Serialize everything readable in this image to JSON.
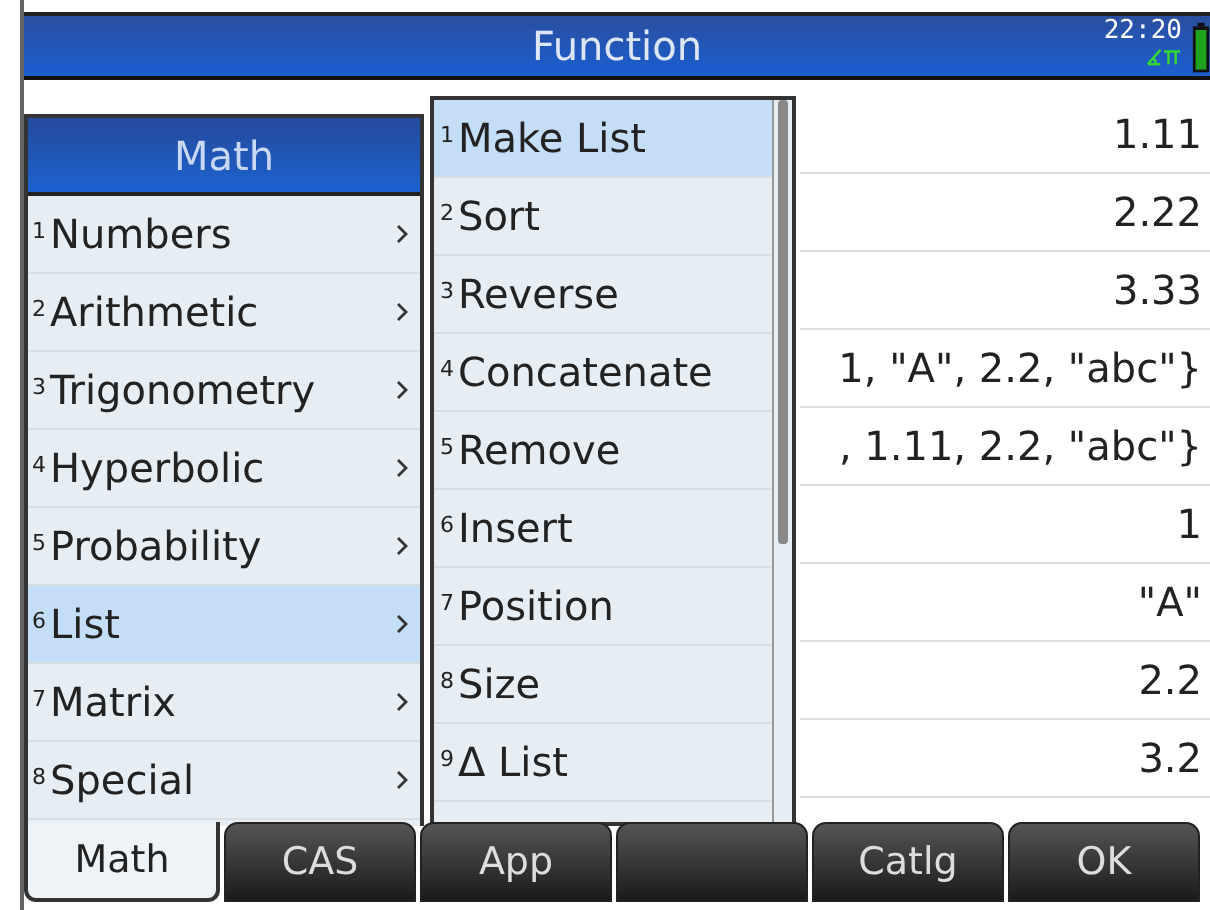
{
  "title_bar": {
    "title": "Function",
    "time": "22:20"
  },
  "history": [
    {
      "value": "1.11"
    },
    {
      "value": "2.22"
    },
    {
      "value": "3.33"
    },
    {
      "value": "1, \"A\", 2.2, \"abc\"}"
    },
    {
      "value": ", 1.11, 2.2, \"abc\"}"
    },
    {
      "value": "1"
    },
    {
      "value": "\"A\""
    },
    {
      "value": "2.2"
    },
    {
      "value": "3.2"
    }
  ],
  "math_menu": {
    "title": "Math",
    "items": [
      {
        "number": "1",
        "label": "Numbers",
        "submenu": true,
        "selected": false
      },
      {
        "number": "2",
        "label": "Arithmetic",
        "submenu": true,
        "selected": false
      },
      {
        "number": "3",
        "label": "Trigonometry",
        "submenu": true,
        "selected": false
      },
      {
        "number": "4",
        "label": "Hyperbolic",
        "submenu": true,
        "selected": false
      },
      {
        "number": "5",
        "label": "Probability",
        "submenu": true,
        "selected": false
      },
      {
        "number": "6",
        "label": "List",
        "submenu": true,
        "selected": true
      },
      {
        "number": "7",
        "label": "Matrix",
        "submenu": true,
        "selected": false
      },
      {
        "number": "8",
        "label": "Special",
        "submenu": true,
        "selected": false
      }
    ]
  },
  "list_submenu": {
    "items": [
      {
        "number": "1",
        "label": "Make List",
        "selected": true
      },
      {
        "number": "2",
        "label": "Sort",
        "selected": false
      },
      {
        "number": "3",
        "label": "Reverse",
        "selected": false
      },
      {
        "number": "4",
        "label": "Concatenate",
        "selected": false
      },
      {
        "number": "5",
        "label": "Remove",
        "selected": false
      },
      {
        "number": "6",
        "label": "Insert",
        "selected": false
      },
      {
        "number": "7",
        "label": "Position",
        "selected": false
      },
      {
        "number": "8",
        "label": "Size",
        "selected": false
      },
      {
        "number": "9",
        "label": "Δ List",
        "selected": false
      }
    ]
  },
  "soft_keys": [
    {
      "label": "Math",
      "selected": true
    },
    {
      "label": "CAS",
      "selected": false
    },
    {
      "label": "App",
      "selected": false
    },
    {
      "selected": false
    },
    {
      "label": "Catlg",
      "selected": false
    },
    {
      "label": "OK",
      "selected": false
    }
  ]
}
